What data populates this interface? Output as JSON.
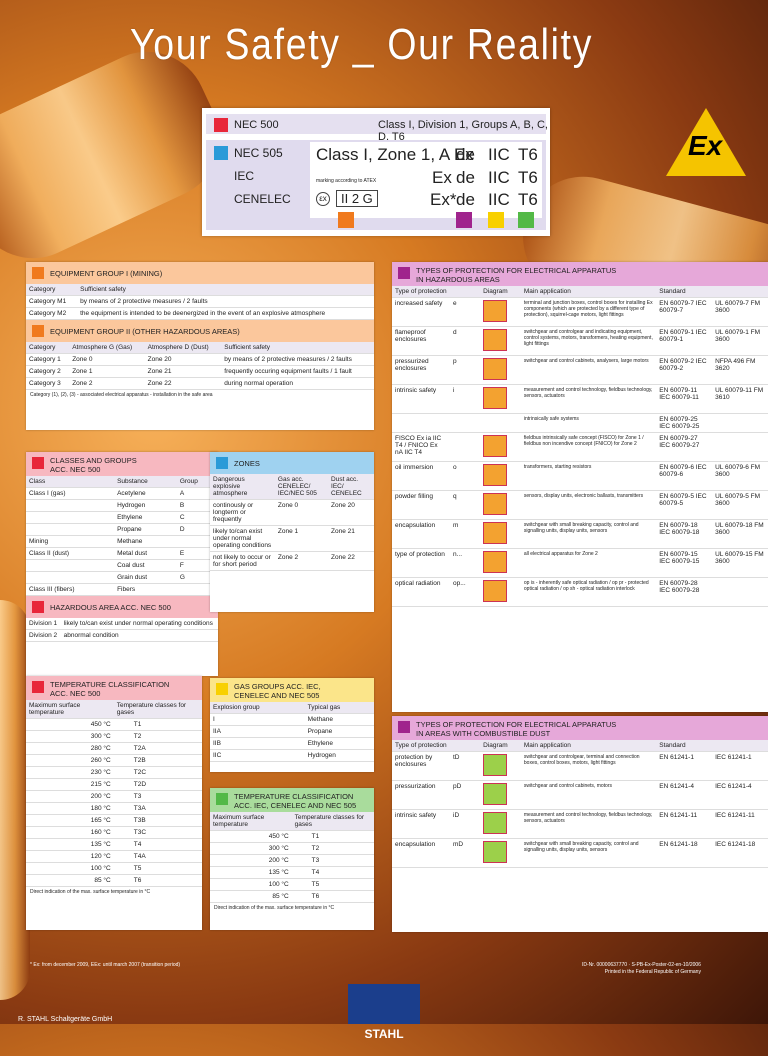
{
  "title": "Your Safety _ Our Reality",
  "marking": {
    "nec500": "NEC 500",
    "nec500_text": "Class I, Division 1, Groups A, B, C, D, T6",
    "nec505": "NEC 505",
    "iec": "IEC",
    "cenelec": "CENELEC",
    "nec505_text": "Class I, Zone 1, A Ex",
    "ex": "Ex",
    "ex_star": "Ex*",
    "de": "de",
    "iic": "IIC",
    "t6": "T6",
    "atex_note": "marking according to ATEX",
    "atex_mark": "II 2 G",
    "colors": {
      "red": "#e8273a",
      "blue": "#2a9ad8",
      "orange": "#f07a1e",
      "purple": "#a0248d",
      "yellow": "#f8d000",
      "green": "#53b947"
    }
  },
  "ex_logo": "Ex",
  "eq_group1": {
    "heading": "EQUIPMENT GROUP I (MINING)",
    "headers": [
      "Category",
      "Sufficient safety"
    ],
    "rows": [
      [
        "Category M1",
        "by means of 2 protective measures / 2 faults"
      ],
      [
        "Category M2",
        "the equipment is intended to be deenergized in the event of an explosive atmosphere"
      ]
    ]
  },
  "eq_group2": {
    "heading": "EQUIPMENT GROUP II (OTHER HAZARDOUS AREAS)",
    "headers": [
      "Category",
      "Atmosphere G (Gas)",
      "Atmosphere D (Dust)",
      "Sufficient safety"
    ],
    "rows": [
      [
        "Category 1",
        "Zone 0",
        "Zone 20",
        "by means of 2 protective measures / 2 faults"
      ],
      [
        "Category 2",
        "Zone 1",
        "Zone 21",
        "frequently occuring equipment faults / 1 fault"
      ],
      [
        "Category 3",
        "Zone 2",
        "Zone 22",
        "during normal operation"
      ]
    ],
    "note": "Category (1), (2), (3) - associated electrical apparatus - installation in the safe area"
  },
  "classes": {
    "heading1": "CLASSES AND GROUPS",
    "heading2": "ACC. NEC 500",
    "headers": [
      "Class",
      "Substance",
      "Group"
    ],
    "rows": [
      [
        "Class I (gas)",
        "Acetylene",
        "A"
      ],
      [
        "",
        "Hydrogen",
        "B"
      ],
      [
        "",
        "Ethylene",
        "C"
      ],
      [
        "",
        "Propane",
        "D"
      ],
      [
        "Mining",
        "Methane",
        ""
      ],
      [
        "Class II (dust)",
        "Metal dust",
        "E"
      ],
      [
        "",
        "Coal dust",
        "F"
      ],
      [
        "",
        "Grain dust",
        "G"
      ],
      [
        "Class III (fibers)",
        "Fibers",
        ""
      ]
    ]
  },
  "hazardous": {
    "heading": "HAZARDOUS AREA ACC. NEC 500",
    "rows": [
      [
        "Division 1",
        "likely to/can exist under normal operating conditions"
      ],
      [
        "Division 2",
        "abnormal condition"
      ]
    ]
  },
  "temp_nec": {
    "heading1": "TEMPERATURE CLASSIFICATION",
    "heading2": "ACC. NEC 500",
    "headers": [
      "Maximum surface temperature",
      "Temperature classes for gases"
    ],
    "rows": [
      [
        "450 °C",
        "T1"
      ],
      [
        "300 °C",
        "T2"
      ],
      [
        "280 °C",
        "T2A"
      ],
      [
        "260 °C",
        "T2B"
      ],
      [
        "230 °C",
        "T2C"
      ],
      [
        "215 °C",
        "T2D"
      ],
      [
        "200 °C",
        "T3"
      ],
      [
        "180 °C",
        "T3A"
      ],
      [
        "165 °C",
        "T3B"
      ],
      [
        "160 °C",
        "T3C"
      ],
      [
        "135 °C",
        "T4"
      ],
      [
        "120 °C",
        "T4A"
      ],
      [
        "100 °C",
        "T5"
      ],
      [
        "85 °C",
        "T6"
      ]
    ],
    "note": "Direct indication of the max. surface temperature in °C"
  },
  "zones": {
    "heading": "ZONES",
    "headers": [
      "Dangerous explosive atmosphere",
      "Gas acc. CENELEC/ IEC/NEC 505",
      "Dust acc. IEC/ CENELEC"
    ],
    "rows": [
      [
        "continously or longterm or frequently",
        "Zone 0",
        "Zone 20"
      ],
      [
        "likely to/can exist under normal operating conditions",
        "Zone 1",
        "Zone 21"
      ],
      [
        "not likely to occur or for short period",
        "Zone 2",
        "Zone 22"
      ]
    ]
  },
  "gas_groups": {
    "heading1": "GAS GROUPS ACC. IEC,",
    "heading2": "CENELEC AND NEC 505",
    "headers": [
      "Explosion group",
      "Typical gas"
    ],
    "rows": [
      [
        "I",
        "Methane"
      ],
      [
        "IIA",
        "Propane"
      ],
      [
        "IIB",
        "Ethylene"
      ],
      [
        "IIC",
        "Hydrogen"
      ]
    ]
  },
  "temp_iec": {
    "heading1": "TEMPERATURE CLASSIFICATION",
    "heading2": "ACC. IEC, CENELEC AND NEC 505",
    "headers": [
      "Maximum surface temperature",
      "Temperature classes for gases"
    ],
    "rows": [
      [
        "450 °C",
        "T1"
      ],
      [
        "300 °C",
        "T2"
      ],
      [
        "200 °C",
        "T3"
      ],
      [
        "135 °C",
        "T4"
      ],
      [
        "100 °C",
        "T5"
      ],
      [
        "85 °C",
        "T6"
      ]
    ],
    "note": "Direct indication of the max. surface temperature in °C"
  },
  "types_elec": {
    "heading1": "TYPES OF PROTECTION FOR ELECTRICAL APPARATUS",
    "heading2": "IN HAZARDOUS AREAS",
    "headers": [
      "Type of protection",
      "",
      "Diagram",
      "Main application",
      "Standard",
      ""
    ],
    "rows": [
      [
        "increased safety",
        "e",
        "terminal and junction boxes, control boxes for installing Ex components (which are protected by a different type of protection), squirrel-cage motors, light fittings",
        "EN 60079-7 IEC 60079-7",
        "UL 60079-7 FM 3600"
      ],
      [
        "flameproof enclosures",
        "d",
        "switchgear and controlgear and indicating equipment, control systems, motors, transformers, heating equipment, light fittings",
        "EN 60079-1 IEC 60079-1",
        "UL 60079-1 FM 3600"
      ],
      [
        "pressurized enclosures",
        "p",
        "switchgear and control cabinets, analysers, large motors",
        "EN 60079-2 IEC 60079-2",
        "NFPA 496 FM 3620"
      ],
      [
        "intrinsic safety",
        "i",
        "measurement and control technology, fieldbus technology, sensors, actuators",
        "EN 60079-11 IEC 60079-11",
        "UL 60079-11 FM 3610"
      ],
      [
        "",
        "",
        "intrinsically safe systems",
        "EN 60079-25 IEC 60079-25",
        ""
      ],
      [
        "FISCO Ex ia IIC T4 / FNICO Ex nA IIC T4",
        "",
        "fieldbus intrinsically safe concept (FISCO) for Zone 1 / fieldbus non incendive concept (FNICO) for Zone 2",
        "EN 60079-27 IEC 60079-27",
        ""
      ],
      [
        "oil immersion",
        "o",
        "transformers, starting resistors",
        "EN 60079-6 IEC 60079-6",
        "UL 60079-6 FM 3600"
      ],
      [
        "powder filling",
        "q",
        "sensors, display units, electronic ballasts, transmitters",
        "EN 60079-5 IEC 60079-5",
        "UL 60079-5 FM 3600"
      ],
      [
        "encapsulation",
        "m",
        "switchgear with small breaking capacity, control and signalling units, display units, sensors",
        "EN 60079-18 IEC 60079-18",
        "UL 60079-18 FM 3600"
      ],
      [
        "type of protection",
        "n...",
        "all electrical apparatus for Zone 2",
        "EN 60079-15 IEC 60079-15",
        "UL 60079-15 FM 3600"
      ],
      [
        "optical radiation",
        "op...",
        "op is - inherently safe optical radiation / op pr - protected optical radiation / op sh - optical radiation interlock",
        "EN 60079-28 IEC 60079-28",
        ""
      ]
    ]
  },
  "types_dust": {
    "heading1": "TYPES OF PROTECTION FOR ELECTRICAL APPARATUS",
    "heading2": "IN AREAS WITH COMBUSTIBLE DUST",
    "headers": [
      "Type of protection",
      "",
      "Diagram",
      "Main application",
      "Standard",
      ""
    ],
    "rows": [
      [
        "protection by enclosures",
        "tD",
        "switchgear and controlgear, terminal and connection boxes, control boxes, motors, light fittings",
        "EN 61241-1",
        "IEC 61241-1"
      ],
      [
        "pressurization",
        "pD",
        "switchgear and control cabinets, motors",
        "EN 61241-4",
        "IEC 61241-4"
      ],
      [
        "intrinsic safety",
        "iD",
        "measurement and control technology, fieldbus technology, sensors, actuators",
        "EN 61241-11",
        "IEC 61241-11"
      ],
      [
        "encapsulation",
        "mD",
        "switchgear with small breaking capacity, control and signalling units, display units, sensors",
        "EN 61241-18",
        "IEC 61241-18"
      ]
    ]
  },
  "footer": {
    "left": "* Ex: from december 2009, EEx: until march 2007 (transition period)",
    "right1": "ID-Nr. 00000637770 · S-PB-Ex-Poster-02-en-10/2006",
    "right2": "Printed in the Federal Republic of Germany",
    "company": "R. STAHL Schaltgeräte GmbH",
    "logo": "STAHL"
  }
}
